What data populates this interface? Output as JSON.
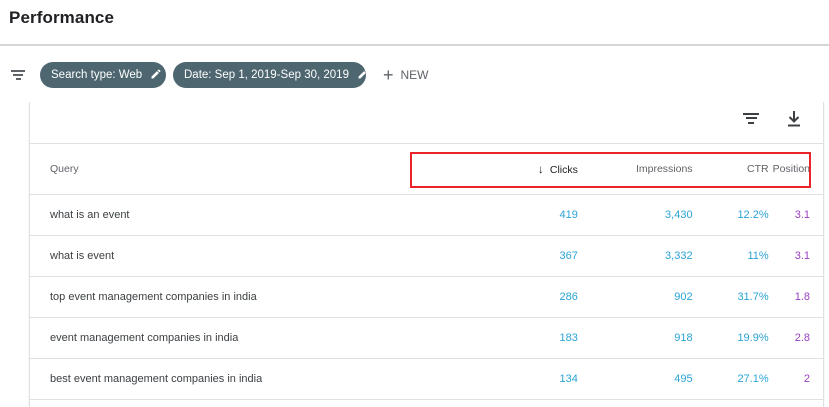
{
  "page": {
    "title": "Performance"
  },
  "filters": {
    "chips": [
      {
        "label": "Search type: Web"
      },
      {
        "label": "Date: Sep 1, 2019-Sep 30, 2019"
      }
    ],
    "new_label": "NEW"
  },
  "table": {
    "columns": {
      "query": "Query",
      "clicks": "Clicks",
      "impressions": "Impressions",
      "ctr": "CTR",
      "position": "Position"
    },
    "sort": {
      "column": "clicks",
      "direction": "descending"
    },
    "rows": [
      {
        "query": "what is an event",
        "clicks": "419",
        "impressions": "3,430",
        "ctr": "12.2%",
        "position": "3.1"
      },
      {
        "query": "what is event",
        "clicks": "367",
        "impressions": "3,332",
        "ctr": "11%",
        "position": "3.1"
      },
      {
        "query": "top event management companies in india",
        "clicks": "286",
        "impressions": "902",
        "ctr": "31.7%",
        "position": "1.8"
      },
      {
        "query": "event management companies in india",
        "clicks": "183",
        "impressions": "918",
        "ctr": "19.9%",
        "position": "2.8"
      },
      {
        "query": "best event management companies in india",
        "clicks": "134",
        "impressions": "495",
        "ctr": "27.1%",
        "position": "2"
      }
    ]
  },
  "colors": {
    "chip_bg": "#4d6670",
    "metric_blue": "#2aa3d6",
    "metric_purple": "#9b3fc1",
    "highlight_red": "#e8232a"
  }
}
